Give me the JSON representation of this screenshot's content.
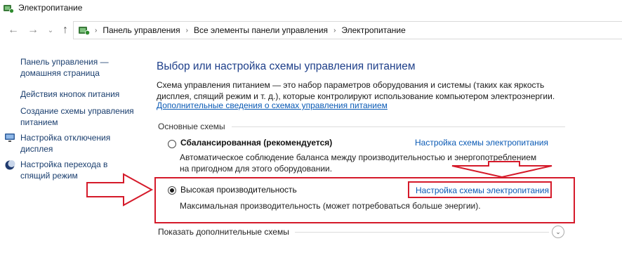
{
  "window": {
    "title": "Электропитание",
    "app_icon": "power-options-icon"
  },
  "nav": {
    "back_icon": "back-arrow-icon",
    "forward_icon": "forward-arrow-icon",
    "history_dropdown_icon": "chevron-down-icon",
    "up_icon": "up-arrow-icon",
    "breadcrumb": [
      "Панель управления",
      "Все элементы панели управления",
      "Электропитание"
    ]
  },
  "sidebar": {
    "items": [
      {
        "label_line1": "Панель управления —",
        "label_line2": "домашняя страница"
      },
      {
        "label_line1": "Действия кнопок питания"
      },
      {
        "label_line1": "Создание схемы управления",
        "label_line2": "питанием"
      },
      {
        "label_line1": "Настройка отключения",
        "label_line2": "дисплея",
        "icon": "display-icon"
      },
      {
        "label_line1": "Настройка перехода в",
        "label_line2": "спящий режим",
        "icon": "moon-icon"
      }
    ]
  },
  "main": {
    "title": "Выбор или настройка схемы управления питанием",
    "description_line1": "Схема управления питанием — это набор параметров оборудования и системы (таких как яркость",
    "description_line2": "дисплея, спящий режим и т. д.), которые контролируют использование компьютером электроэнергии.",
    "more_info_link": "Дополнительные сведения о схемах управления питанием",
    "section_label": "Основные схемы",
    "plans": [
      {
        "name": "Сбалансированная (рекомендуется)",
        "selected": false,
        "desc_line1": "Автоматическое соблюдение баланса между производительностью и энергопотреблением",
        "desc_line2": "на пригодном для этого оборудовании.",
        "link": "Настройка схемы электропитания"
      },
      {
        "name": "Высокая производительность",
        "selected": true,
        "desc_line1": "Максимальная производительность (может потребоваться больше энергии).",
        "link": "Настройка схемы электропитания"
      }
    ],
    "show_more": "Показать дополнительные схемы",
    "expander_icon": "chevron-down-icon"
  },
  "annotation": {
    "color": "#d51a2a"
  }
}
